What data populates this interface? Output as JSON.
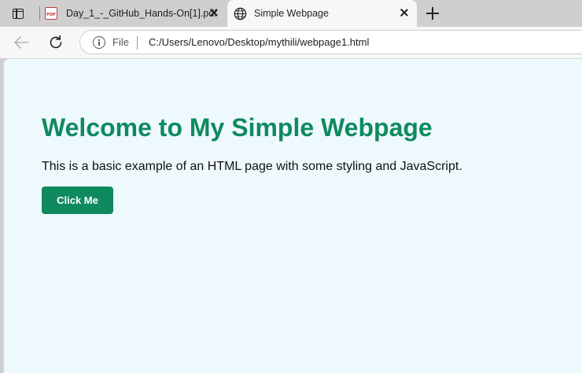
{
  "browser": {
    "tabs": [
      {
        "title": "Day_1_-_GitHub_Hands-On[1].pdf",
        "favicon": "pdf-icon",
        "favicon_text": "PDF",
        "active": false
      },
      {
        "title": "Simple Webpage",
        "favicon": "globe-icon",
        "active": true
      }
    ],
    "address_bar": {
      "scheme_label": "File",
      "url": "C:/Users/Lenovo/Desktop/mythili/webpage1.html"
    }
  },
  "page": {
    "heading": "Welcome to My Simple Webpage",
    "paragraph": "This is a basic example of an HTML page with some styling and JavaScript.",
    "button_label": "Click Me"
  },
  "colors": {
    "accent": "#0f8a5f",
    "page_background": "#eef9fd",
    "chrome_background": "#cfcfcf"
  }
}
